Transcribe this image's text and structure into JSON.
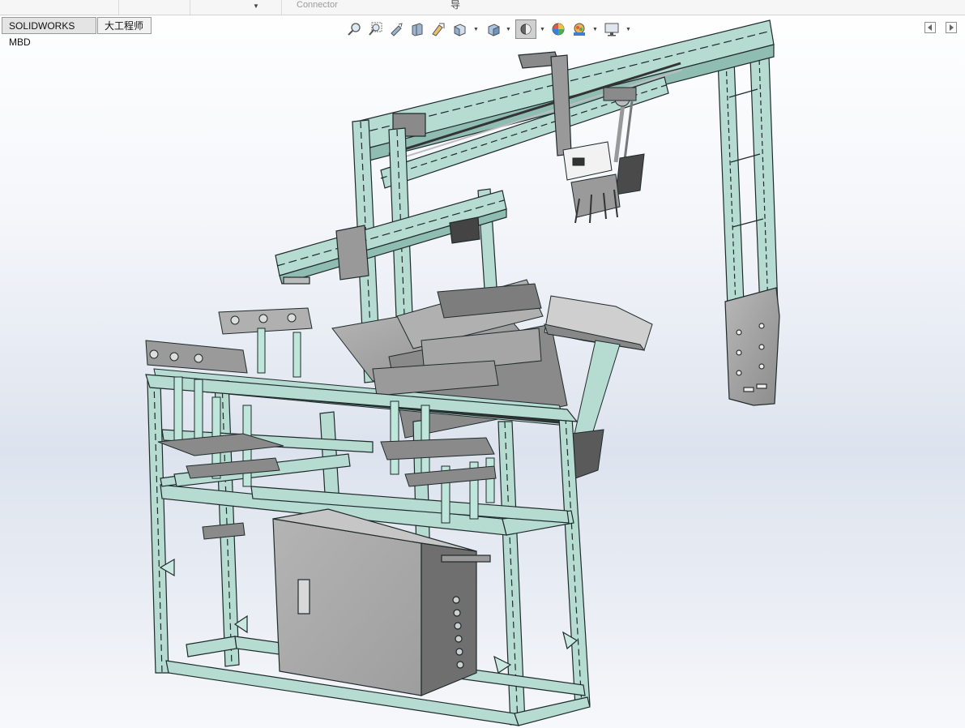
{
  "ribbon": {
    "connector_label": "Connector",
    "partial_glyph": "导"
  },
  "tabs": [
    {
      "label": "SOLIDWORKS MBD",
      "active": false
    },
    {
      "label": "大工程师",
      "active": true
    }
  ],
  "heads_up_toolbar": {
    "buttons": [
      {
        "name": "zoom-to-fit-icon"
      },
      {
        "name": "zoom-to-area-icon"
      },
      {
        "name": "previous-view-icon"
      },
      {
        "name": "section-view-icon"
      },
      {
        "name": "dynamic-annotation-icon"
      },
      {
        "name": "view-orientation-icon"
      },
      {
        "name": "display-style-icon"
      },
      {
        "name": "hide-show-items-icon"
      },
      {
        "name": "edit-appearance-icon"
      },
      {
        "name": "apply-scene-icon"
      },
      {
        "name": "view-settings-icon"
      }
    ]
  },
  "colors": {
    "frame": "#b6dcd2",
    "frame_edge": "#1f2a2a",
    "metal_dark": "#7a7a7a",
    "metal_plate": "#9c9c9c",
    "cabinet": "#a9a9a9",
    "cylinder": "#bfe6da",
    "hud_pressed": "#d0d0d0"
  }
}
